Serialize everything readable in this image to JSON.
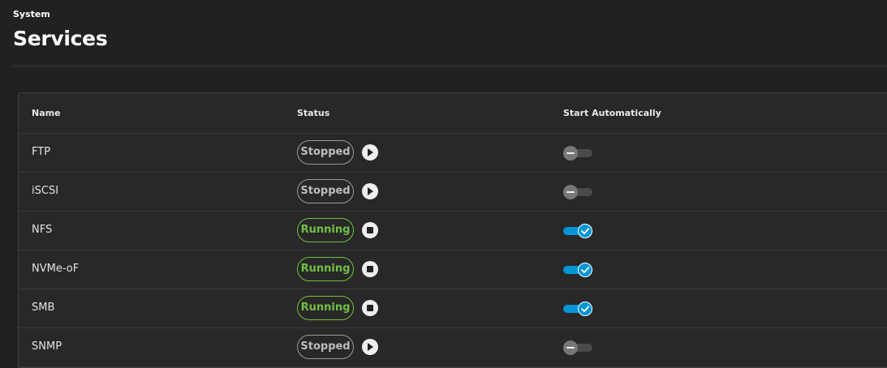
{
  "header": {
    "breadcrumb": "System",
    "title": "Services"
  },
  "table": {
    "columns": {
      "name": "Name",
      "status": "Status",
      "start_automatically": "Start Automatically"
    },
    "rows": [
      {
        "name": "FTP",
        "status": "Stopped",
        "auto_start": false
      },
      {
        "name": "iSCSI",
        "status": "Stopped",
        "auto_start": false
      },
      {
        "name": "NFS",
        "status": "Running",
        "auto_start": true
      },
      {
        "name": "NVMe-oF",
        "status": "Running",
        "auto_start": true
      },
      {
        "name": "SMB",
        "status": "Running",
        "auto_start": true
      },
      {
        "name": "SNMP",
        "status": "Stopped",
        "auto_start": false
      }
    ]
  },
  "colors": {
    "background": "#212121",
    "card": "#282828",
    "running": "#71bf44",
    "stopped": "#bdbdbd",
    "toggle_on": "#0095d5",
    "toggle_off": "#4a4a4a"
  },
  "icons": {
    "start": "play-icon",
    "stop": "stop-icon",
    "toggle_on": "check-icon",
    "toggle_off": "minus-icon"
  }
}
